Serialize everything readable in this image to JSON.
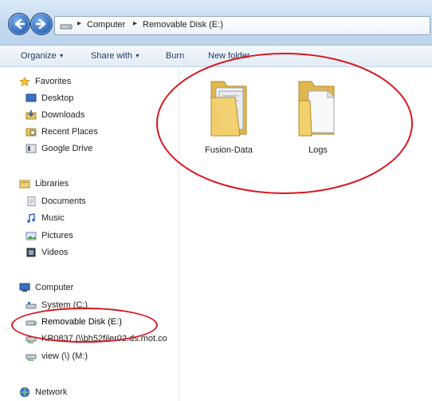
{
  "address_bar": {
    "crumbs": [
      "Computer",
      "Removable Disk (E:)"
    ]
  },
  "toolbar": {
    "organize": "Organize",
    "share_with": "Share with",
    "burn": "Burn",
    "new_folder": "New folder"
  },
  "sidebar": {
    "favorites": {
      "header": "Favorites",
      "items": [
        "Desktop",
        "Downloads",
        "Recent Places",
        "Google Drive"
      ]
    },
    "libraries": {
      "header": "Libraries",
      "items": [
        "Documents",
        "Music",
        "Pictures",
        "Videos"
      ]
    },
    "computer": {
      "header": "Computer",
      "items": [
        "System (C:)",
        "Removable Disk (E:)",
        "KR0837 (\\\\bh52filer02.ds.mot.co",
        "view (\\) (M:)"
      ]
    },
    "network": {
      "header": "Network"
    }
  },
  "content": {
    "folders": [
      "Fusion-Data",
      "Logs"
    ]
  },
  "colors": {
    "annotation_ring": "#d8151c",
    "folder_yellow": "#f2d06b",
    "nav_blue": "#2a64b8"
  }
}
